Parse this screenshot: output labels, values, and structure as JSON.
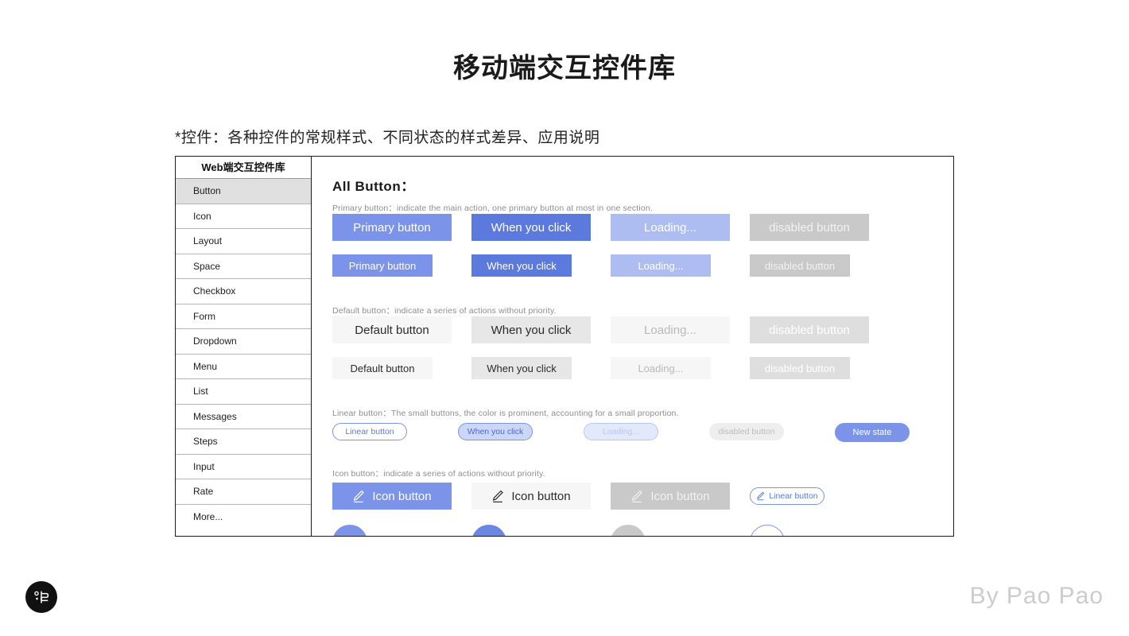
{
  "page": {
    "title": "移动端交互控件库",
    "subtitle": "*控件：各种控件的常规样式、不同状态的样式差异、应用说明"
  },
  "sidebar": {
    "header": "Web端交互控件库",
    "items": [
      {
        "label": "Button",
        "active": true
      },
      {
        "label": "Icon",
        "active": false
      },
      {
        "label": "Layout",
        "active": false
      },
      {
        "label": "Space",
        "active": false
      },
      {
        "label": "Checkbox",
        "active": false
      },
      {
        "label": "Form",
        "active": false
      },
      {
        "label": "Dropdown",
        "active": false
      },
      {
        "label": "Menu",
        "active": false
      },
      {
        "label": "List",
        "active": false
      },
      {
        "label": "Messages",
        "active": false
      },
      {
        "label": "Steps",
        "active": false
      },
      {
        "label": "Input",
        "active": false
      },
      {
        "label": "Rate",
        "active": false
      },
      {
        "label": "More...",
        "active": false
      }
    ]
  },
  "main": {
    "section_title": "All Button：",
    "groups": {
      "primary": {
        "caption": "Primary button：indicate the main action, one primary button at most in one section.",
        "large": [
          "Primary button",
          "When you click",
          "Loading...",
          "disabled button"
        ],
        "small": [
          "Primary button",
          "When you click",
          "Loading...",
          "disabled button"
        ]
      },
      "default": {
        "caption": "Default button：indicate a series of actions without priority.",
        "large": [
          "Default button",
          "When you click",
          "Loading...",
          "disabled button"
        ],
        "small": [
          "Default button",
          "When you click",
          "Loading...",
          "disabled button"
        ]
      },
      "linear": {
        "caption": "Linear button：The small buttons, the color is prominent, accounting for a small proportion.",
        "items": [
          "Linear button",
          "When you click",
          "Loading...",
          "disabled button",
          "New state"
        ]
      },
      "icon": {
        "caption": "Icon button：indicate a series of actions without priority.",
        "items": [
          "Icon button",
          "Icon button",
          "Icon button",
          "Linear button"
        ],
        "icon_name": "pencil-edit-icon"
      }
    }
  },
  "colors": {
    "primary": "#7b93e8",
    "primary_active": "#5c7ade",
    "primary_loading": "#adbdf2",
    "disabled": "#c9c9c9",
    "default_bg": "#f6f6f6",
    "default_active": "#e7e7e7"
  },
  "footer": {
    "credit": "By Pao Pao",
    "logo_name": "pao-pao-logo"
  }
}
